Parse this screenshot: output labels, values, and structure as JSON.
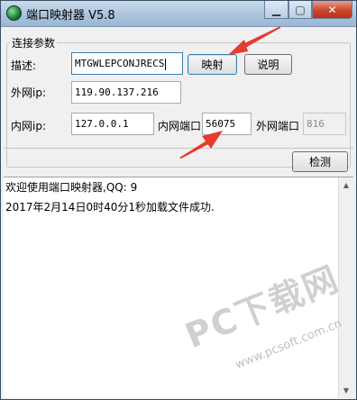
{
  "window": {
    "title": "端口映射器 V5.8"
  },
  "group": {
    "label": "连接参数"
  },
  "desc": {
    "label": "描述:",
    "value": "MTGWLEPCONJRECS"
  },
  "buttons": {
    "map": "映射",
    "help": "说明",
    "detect": "检测"
  },
  "external_ip": {
    "label": "外网ip:",
    "value": "119.90.137.216"
  },
  "internal_ip": {
    "label": "内网ip:",
    "value": "127.0.0.1"
  },
  "internal_port": {
    "label": "内网端口",
    "value": "56075"
  },
  "external_port": {
    "label": "外网端口",
    "value": "816"
  },
  "log": {
    "lines": [
      "欢迎使用端口映射器,QQ:           9",
      "2017年2月14日0时40分1秒加载文件成功."
    ]
  },
  "watermark": {
    "text": "PC下载网",
    "url": "www.pcsoft.com.cn"
  },
  "colors": {
    "annotation_arrow": "#e63b2e"
  }
}
